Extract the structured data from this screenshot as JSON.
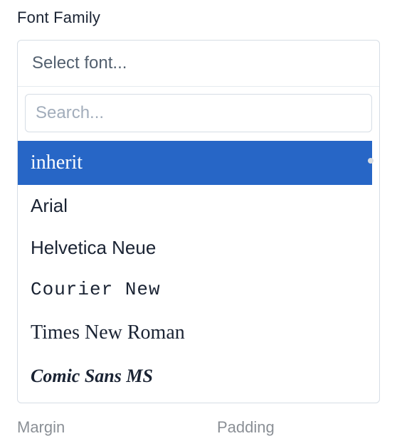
{
  "field": {
    "label": "Font Family",
    "placeholder": "Select font..."
  },
  "search": {
    "placeholder": "Search..."
  },
  "options": [
    {
      "label": "inherit"
    },
    {
      "label": "Arial"
    },
    {
      "label": "Helvetica Neue"
    },
    {
      "label": "Courier New"
    },
    {
      "label": "Times New Roman"
    },
    {
      "label": "Comic Sans MS"
    }
  ],
  "background": {
    "left": "Margin",
    "right": "Padding"
  }
}
